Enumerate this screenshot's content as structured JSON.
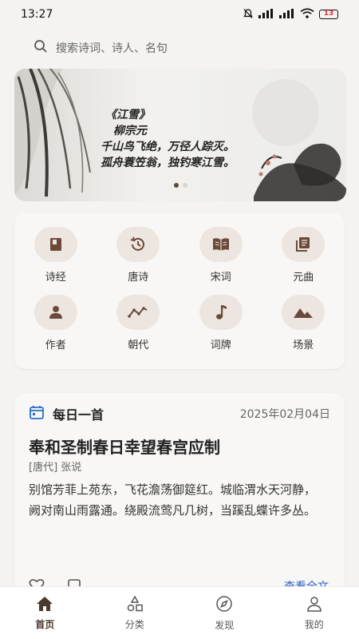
{
  "status_bar": {
    "time": "13:27",
    "battery": "13"
  },
  "search": {
    "placeholder": "搜索诗词、诗人、名句"
  },
  "banner": {
    "title": "《江雪》",
    "author": "柳宗元",
    "line1": "千山鸟飞绝，万径人踪灭。",
    "line2": "孤舟蓑笠翁，独钓寒江雪。"
  },
  "categories": [
    {
      "label": "诗经",
      "icon": "book-icon"
    },
    {
      "label": "唐诗",
      "icon": "history-icon"
    },
    {
      "label": "宋词",
      "icon": "open-book-icon"
    },
    {
      "label": "元曲",
      "icon": "library-icon"
    },
    {
      "label": "作者",
      "icon": "person-icon"
    },
    {
      "label": "朝代",
      "icon": "timeline-icon"
    },
    {
      "label": "词牌",
      "icon": "music-note-icon"
    },
    {
      "label": "场景",
      "icon": "mountain-icon"
    }
  ],
  "daily": {
    "heading": "每日一首",
    "date": "2025年02月04日",
    "title": "奉和圣制春日幸望春宫应制",
    "author": "[唐代] 张说",
    "lines": [
      "别馆芳菲上苑东，飞花澹荡御筵红。城临渭水天河静，",
      "阙对南山雨露通。绕殿流莺凡几树，当蹊乱蝶许多丛。"
    ],
    "view_all": "查看全文"
  },
  "tabs": [
    {
      "label": "首页",
      "icon": "home-icon",
      "active": true
    },
    {
      "label": "分类",
      "icon": "category-icon",
      "active": false
    },
    {
      "label": "发现",
      "icon": "compass-icon",
      "active": false
    },
    {
      "label": "我的",
      "icon": "user-icon",
      "active": false
    }
  ],
  "colors": {
    "accent": "#5a4a3a",
    "icon_bg": "#ede5df",
    "link": "#2a60c8"
  }
}
